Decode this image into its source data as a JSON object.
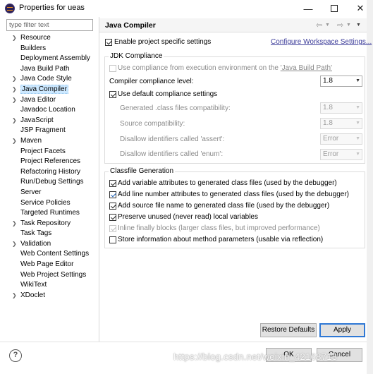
{
  "window": {
    "title": "Properties for ueas"
  },
  "left_pane": {
    "filter_placeholder": "type filter text",
    "tree_items": [
      {
        "label": "Resource",
        "expandable": true
      },
      {
        "label": "Builders",
        "expandable": false
      },
      {
        "label": "Deployment Assembly",
        "expandable": false
      },
      {
        "label": "Java Build Path",
        "expandable": false
      },
      {
        "label": "Java Code Style",
        "expandable": true
      },
      {
        "label": "Java Compiler",
        "expandable": true,
        "selected": true
      },
      {
        "label": "Java Editor",
        "expandable": true
      },
      {
        "label": "Javadoc Location",
        "expandable": false
      },
      {
        "label": "JavaScript",
        "expandable": true
      },
      {
        "label": "JSP Fragment",
        "expandable": false
      },
      {
        "label": "Maven",
        "expandable": true
      },
      {
        "label": "Project Facets",
        "expandable": false
      },
      {
        "label": "Project References",
        "expandable": false
      },
      {
        "label": "Refactoring History",
        "expandable": false
      },
      {
        "label": "Run/Debug Settings",
        "expandable": false
      },
      {
        "label": "Server",
        "expandable": false
      },
      {
        "label": "Service Policies",
        "expandable": false
      },
      {
        "label": "Targeted Runtimes",
        "expandable": false
      },
      {
        "label": "Task Repository",
        "expandable": true
      },
      {
        "label": "Task Tags",
        "expandable": false
      },
      {
        "label": "Validation",
        "expandable": true
      },
      {
        "label": "Web Content Settings",
        "expandable": false
      },
      {
        "label": "Web Page Editor",
        "expandable": false
      },
      {
        "label": "Web Project Settings",
        "expandable": false
      },
      {
        "label": "WikiText",
        "expandable": false
      },
      {
        "label": "XDoclet",
        "expandable": true
      }
    ]
  },
  "page": {
    "title": "Java Compiler",
    "enable_specific": {
      "label": "Enable project specific settings",
      "checked": true
    },
    "configure_link": "Configure Workspace Settings...",
    "jdk": {
      "title": "JDK Compliance",
      "use_env_prefix": "Use compliance from execution environment on the ",
      "use_env_path": "'Java Build Path'",
      "compliance_level_label": "Compiler compliance level:",
      "compliance_level_value": "1.8",
      "use_default_label": "Use default compliance settings",
      "generated_label": "Generated .class files compatibility:",
      "generated_value": "1.8",
      "source_label": "Source compatibility:",
      "source_value": "1.8",
      "assert_label": "Disallow identifiers called 'assert':",
      "assert_value": "Error",
      "enum_label": "Disallow identifiers called 'enum':",
      "enum_value": "Error"
    },
    "classfile": {
      "title": "Classfile Generation",
      "options": [
        {
          "label": "Add variable attributes to generated class files (used by the debugger)",
          "checked": true,
          "disabled": false
        },
        {
          "label": "Add line number attributes to generated class files (used by the debugger)",
          "checked": true,
          "disabled": false
        },
        {
          "label": "Add source file name to generated class file (used by the debugger)",
          "checked": true,
          "disabled": false
        },
        {
          "label": "Preserve unused (never read) local variables",
          "checked": true,
          "disabled": false
        },
        {
          "label": "Inline finally blocks (larger class files, but improved performance)",
          "checked": true,
          "disabled": true
        },
        {
          "label": "Store information about method parameters (usable via reflection)",
          "checked": false,
          "disabled": false
        }
      ]
    },
    "restore_defaults_label": "Restore Defaults",
    "apply_label": "Apply"
  },
  "footer": {
    "help_icon": "?",
    "ok_label": "OK",
    "cancel_label": "Cancel"
  },
  "watermark": "https://blog.csdn.net/weixin_42168713",
  "icons": {
    "app": "eclipse-icon",
    "back": "back-arrow-icon",
    "forward": "forward-arrow-icon",
    "menu": "view-menu-icon",
    "help": "help-icon"
  }
}
